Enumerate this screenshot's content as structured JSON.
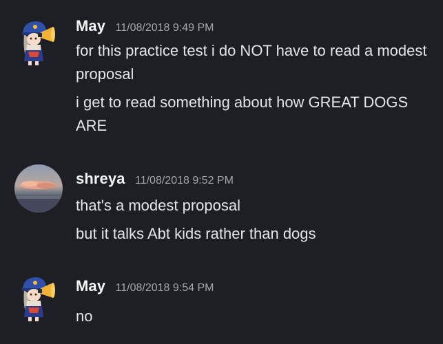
{
  "messages": [
    {
      "username": "May",
      "timestamp": "11/08/2018 9:49 PM",
      "avatar": "anime-girl-megaphone-avatar",
      "lines": [
        "for this practice test i do NOT have to read a modest proposal",
        "i get to read something about how GREAT DOGS ARE"
      ]
    },
    {
      "username": "shreya",
      "timestamp": "11/08/2018 9:52 PM",
      "avatar": "sunset-clouds-avatar",
      "lines": [
        "that's a modest proposal",
        "but it talks Abt kids rather than dogs"
      ]
    },
    {
      "username": "May",
      "timestamp": "11/08/2018 9:54 PM",
      "avatar": "anime-girl-megaphone-avatar",
      "lines": [
        "no"
      ]
    }
  ],
  "colors": {
    "background": "#1e1f24",
    "username": "#f2f3f5",
    "timestamp": "#a3a6ad",
    "text": "#e3e5e8"
  }
}
